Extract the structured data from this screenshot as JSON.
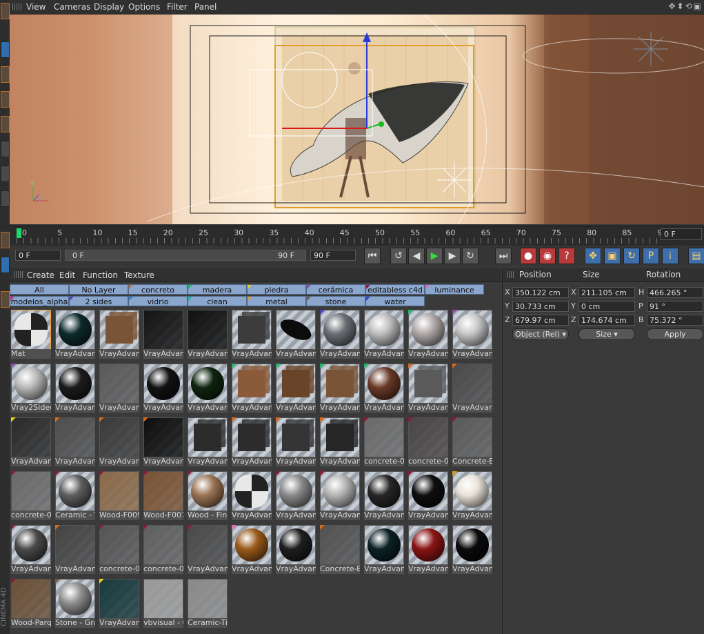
{
  "menubar": {
    "items": [
      "View",
      "Cameras",
      "Display",
      "Options",
      "Filter",
      "Panel"
    ],
    "nav_icons": "✥⬍⟲▣"
  },
  "viewport": {
    "axis_labels": [
      "Y",
      "Z",
      "X"
    ]
  },
  "timeline": {
    "ticks": [
      "0",
      "5",
      "10",
      "15",
      "20",
      "25",
      "30",
      "35",
      "40",
      "45",
      "50",
      "55",
      "60",
      "65",
      "70",
      "75",
      "80",
      "85",
      "90"
    ],
    "current_frame": "0 F"
  },
  "transport": {
    "start_frame": "0 F",
    "range_start": "0 F",
    "range_end": "90 F",
    "end_frame": "90 F"
  },
  "material_manager": {
    "menu": [
      "Create",
      "Edit",
      "Function",
      "Texture"
    ],
    "layer_tabs_row1": [
      {
        "label": "All",
        "color": ""
      },
      {
        "label": "No Layer",
        "color": ""
      },
      {
        "label": "concreto",
        "color": "#d86a1a"
      },
      {
        "label": "madera",
        "color": "#1fb86a"
      },
      {
        "label": "piedra",
        "color": "#e8d21a"
      },
      {
        "label": "cerámica",
        "color": "#8a4ab8"
      },
      {
        "label": "editabless c4d",
        "color": "#8a1a3a"
      },
      {
        "label": "luminance",
        "color": "#e86ab0"
      }
    ],
    "layer_tabs_row2": [
      {
        "label": "modelos_alpha",
        "color": "#c82a8a"
      },
      {
        "label": "2 sides",
        "color": "#5a3ab8"
      },
      {
        "label": "vidrio",
        "color": "#1a8ac8"
      },
      {
        "label": "clean",
        "color": "#1ab8a0"
      },
      {
        "label": "metal",
        "color": "#d8a01a"
      },
      {
        "label": "stone",
        "color": "#7a5a3a"
      },
      {
        "label": "water",
        "color": "#2a4ab8"
      }
    ],
    "materials": [
      [
        {
          "label": "Mat",
          "kind": "dress",
          "color": "#888888",
          "tag": ""
        },
        {
          "label": "VrayAdvanc",
          "kind": "sphere",
          "color": "#0e2a2c",
          "tag": ""
        },
        {
          "label": "VrayAdvanc",
          "kind": "cube",
          "color": "#7a5436",
          "tag": ""
        },
        {
          "label": "VrayAdvanc",
          "kind": "flat",
          "color": "#141414",
          "tag": ""
        },
        {
          "label": "VrayAdvanc",
          "kind": "flat",
          "color": "#101010",
          "tag": ""
        },
        {
          "label": "VrayAdvanc",
          "kind": "cube",
          "color": "#3c3c3c",
          "tag": ""
        },
        {
          "label": "VrayAdvanc",
          "kind": "disc",
          "color": "#0c0c0c",
          "tag": ""
        },
        {
          "label": "VrayAdvanc",
          "kind": "sphere",
          "color": "#6a6e74",
          "tag": "#5a3ab8"
        },
        {
          "label": "VrayAdvanc",
          "kind": "sphere",
          "color": "#bdbdbd",
          "tag": ""
        },
        {
          "label": "VrayAdvanc",
          "kind": "sphere",
          "color": "#b0a8a8",
          "tag": "#1fb86a"
        },
        {
          "label": "VrayAdvanc",
          "kind": "sphere",
          "color": "#c8c8c8",
          "tag": "#8a4ab8"
        }
      ],
      [
        {
          "label": "Vray2Sided",
          "kind": "sphere",
          "color": "#b8b8b8",
          "tag": "#8a4ab8"
        },
        {
          "label": "VrayAdvanc",
          "kind": "sphere",
          "color": "#1c1c1c",
          "tag": ""
        },
        {
          "label": "VrayAdvanc",
          "kind": "flat",
          "color": "#5a5a5a",
          "tag": ""
        },
        {
          "label": "VrayAdvanc",
          "kind": "sphere",
          "color": "#121212",
          "tag": ""
        },
        {
          "label": "VrayAdvanc",
          "kind": "sphere",
          "color": "#0f240f",
          "tag": ""
        },
        {
          "label": "VrayAdvanc",
          "kind": "cube",
          "color": "#8a5a3a",
          "tag": "#1fb86a"
        },
        {
          "label": "VrayAdvanc",
          "kind": "cube",
          "color": "#6a4428",
          "tag": "#1fb86a"
        },
        {
          "label": "VrayAdvanc",
          "kind": "cube",
          "color": "#7a5436",
          "tag": "#1fb86a"
        },
        {
          "label": "VrayAdvanc",
          "kind": "sphere",
          "color": "#6a3a28",
          "tag": "#1fb86a"
        },
        {
          "label": "VrayAdvanc",
          "kind": "cube",
          "color": "#5a5a5a",
          "tag": "#d86a1a"
        },
        {
          "label": "VrayAdvanc",
          "kind": "flat",
          "color": "#4a4a4a",
          "tag": "#d86a1a"
        }
      ],
      [
        {
          "label": "VrayAdvanc",
          "kind": "flat",
          "color": "#2a2a2a",
          "tag": "#e8d21a"
        },
        {
          "label": "VrayAdvanc",
          "kind": "flat",
          "color": "#4e4e4e",
          "tag": "#d86a1a"
        },
        {
          "label": "VrayAdvanc",
          "kind": "flat",
          "color": "#3a3a3a",
          "tag": "#d86a1a"
        },
        {
          "label": "VrayAdvanc",
          "kind": "flat",
          "color": "#0e0e0e",
          "tag": "#d86a1a"
        },
        {
          "label": "VrayAdvanc",
          "kind": "cube",
          "color": "#2c2c2c",
          "tag": ""
        },
        {
          "label": "VrayAdvanc",
          "kind": "cube",
          "color": "#2c2c2c",
          "tag": "#d86a1a"
        },
        {
          "label": "VrayAdvanc",
          "kind": "cube",
          "color": "#353535",
          "tag": "#d86a1a"
        },
        {
          "label": "VrayAdvanc",
          "kind": "cube",
          "color": "#262626",
          "tag": "#d86a1a"
        },
        {
          "label": "concrete-02",
          "kind": "flat",
          "color": "#6a6a6a",
          "tag": "#8a1a3a"
        },
        {
          "label": "concrete-00",
          "kind": "flat",
          "color": "#4a4646",
          "tag": "#8a1a3a"
        },
        {
          "label": "Concrete-B",
          "kind": "flat",
          "color": "#5a5a5a",
          "tag": "#8a1a3a"
        }
      ],
      [
        {
          "label": "concrete-02",
          "kind": "flat",
          "color": "#6a6a6a",
          "tag": "#8a1a3a"
        },
        {
          "label": "Ceramic - T",
          "kind": "sphere",
          "color": "#5e5e5e",
          "tag": "#8a1a3a"
        },
        {
          "label": "Wood-F009",
          "kind": "flat",
          "color": "#8a6a4a",
          "tag": "#8a1a3a"
        },
        {
          "label": "Wood-F007",
          "kind": "flat",
          "color": "#7a5436",
          "tag": "#8a1a3a"
        },
        {
          "label": "Wood - Fin",
          "kind": "sphere",
          "color": "#9a7454",
          "tag": "#8a1a3a"
        },
        {
          "label": "VrayAdvanc",
          "kind": "dress",
          "color": "#cccccc",
          "tag": ""
        },
        {
          "label": "VrayAdvanc",
          "kind": "sphere",
          "color": "#8a8a8a",
          "tag": "#8a1a3a"
        },
        {
          "label": "VrayAdvanc",
          "kind": "sphere",
          "color": "#b4b4b4",
          "tag": "#8a1a3a"
        },
        {
          "label": "VrayAdvanc",
          "kind": "sphere",
          "color": "#262626",
          "tag": ""
        },
        {
          "label": "VrayAdvanc",
          "kind": "sphere",
          "color": "#0e0e0e",
          "tag": "#8a1a3a"
        },
        {
          "label": "VrayAdvanc",
          "kind": "sphere",
          "color": "#e8e2d8",
          "tag": "#d8a01a"
        }
      ],
      [
        {
          "label": "VrayAdvanc",
          "kind": "sphere",
          "color": "#4a4a4a",
          "tag": "#8a1a3a"
        },
        {
          "label": "VrayAdvanc",
          "kind": "flat",
          "color": "#444444",
          "tag": "#d86a1a"
        },
        {
          "label": "concrete-00",
          "kind": "flat",
          "color": "#555555",
          "tag": "#8a1a3a"
        },
        {
          "label": "concrete-00",
          "kind": "flat",
          "color": "#606060",
          "tag": "#8a1a3a"
        },
        {
          "label": "VrayAdvanc",
          "kind": "flat",
          "color": "#4a4a4a",
          "tag": "#8a1a3a"
        },
        {
          "label": "VrayAdvanc",
          "kind": "sphere",
          "color": "#9a5a1a",
          "tag": "#e86ab0"
        },
        {
          "label": "VrayAdvanc",
          "kind": "sphere",
          "color": "#1e1e1e",
          "tag": ""
        },
        {
          "label": "Concrete-B",
          "kind": "flat",
          "color": "#525252",
          "tag": "#d86a1a"
        },
        {
          "label": "VrayAdvanc",
          "kind": "sphere",
          "color": "#0c2024",
          "tag": ""
        },
        {
          "label": "VrayAdvanc",
          "kind": "sphere",
          "color": "#8a1414",
          "tag": ""
        },
        {
          "label": "VrayAdvanc",
          "kind": "sphere",
          "color": "#0a0a0a",
          "tag": ""
        }
      ],
      [
        {
          "label": "Wood-Parq",
          "kind": "flat",
          "color": "#6a5038",
          "tag": "#8a1a3a"
        },
        {
          "label": "Stone - Gra",
          "kind": "sphere",
          "color": "#8e8e8e",
          "tag": "#7a5a3a"
        },
        {
          "label": "VrayAdvanc",
          "kind": "flat",
          "color": "#1a3a3e",
          "tag": "#e8d21a"
        },
        {
          "label": "vbvisual - C",
          "kind": "flat",
          "color": "#9a9a9a",
          "tag": ""
        },
        {
          "label": "Ceramic-Til",
          "kind": "flat",
          "color": "#8a8a8a",
          "tag": ""
        }
      ]
    ]
  },
  "coordinates": {
    "headers": [
      "Position",
      "Size",
      "Rotation"
    ],
    "rows": [
      {
        "axis": "X",
        "pos": "350.122 cm",
        "size_axis": "X",
        "size": "211.105 cm",
        "rot_axis": "H",
        "rot": "466.265 °"
      },
      {
        "axis": "Y",
        "pos": "30.733 cm",
        "size_axis": "Y",
        "size": "0 cm",
        "rot_axis": "P",
        "rot": "91 °"
      },
      {
        "axis": "Z",
        "pos": "679.97 cm",
        "size_axis": "Z",
        "size": "174.674 cm",
        "rot_axis": "B",
        "rot": "75.372 °"
      }
    ],
    "mode_dropdown": "Object (Rel)",
    "size_dropdown": "Size",
    "apply_label": "Apply"
  },
  "branding": {
    "logo_text": "CINEMA 4D"
  }
}
